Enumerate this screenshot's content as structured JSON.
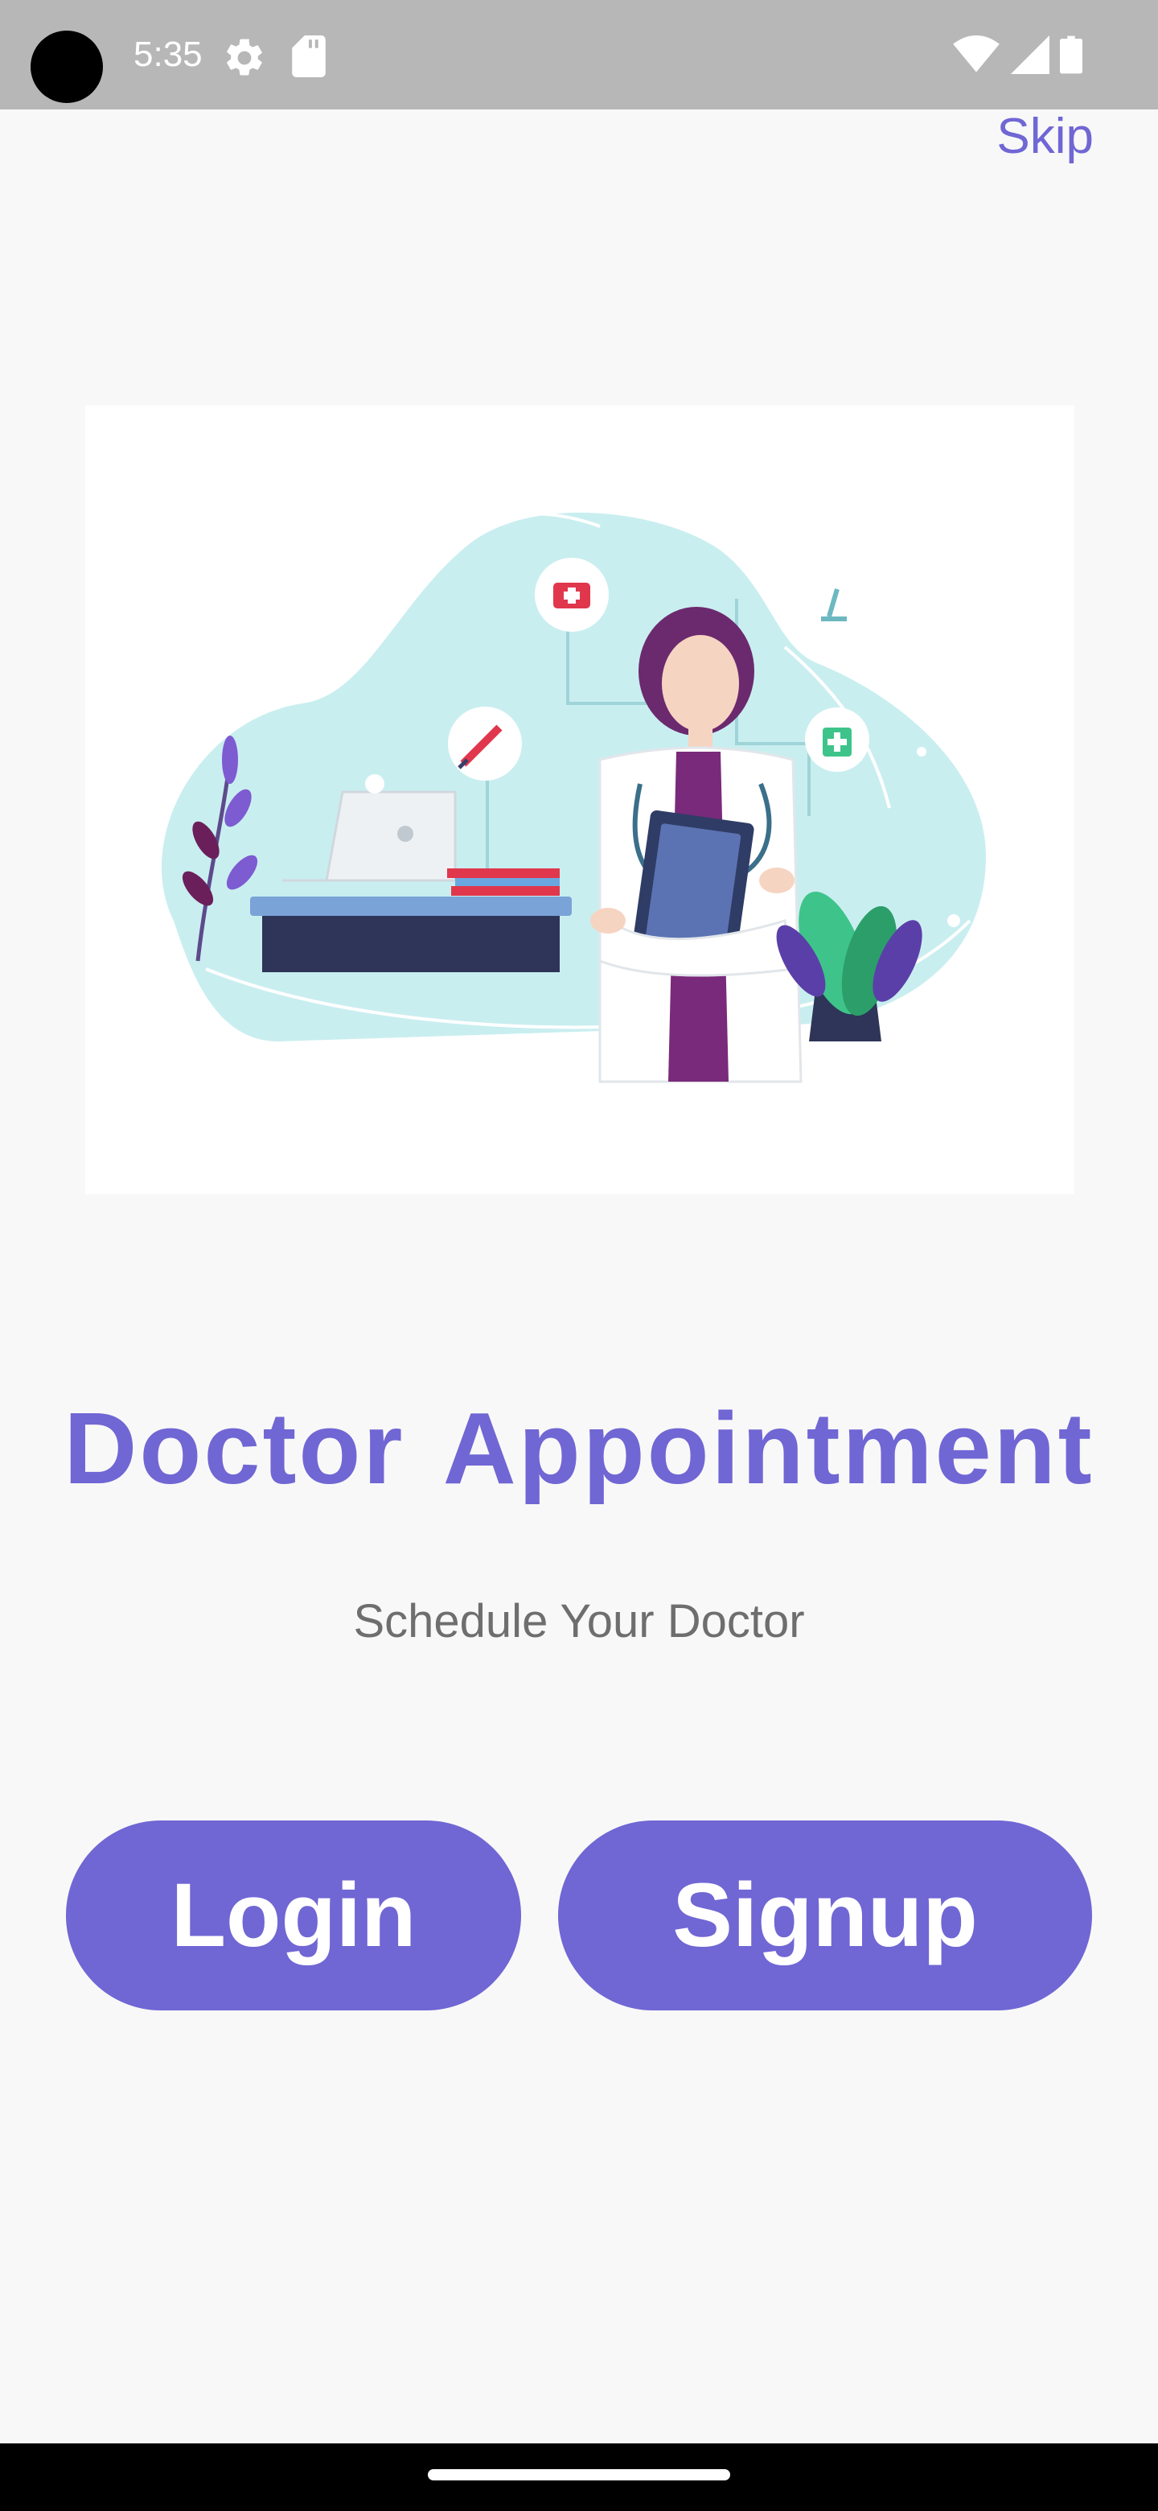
{
  "status_bar": {
    "time": "5:35",
    "icons": [
      "settings-gear-icon",
      "sd-card-icon",
      "wifi-icon",
      "cellular-signal-icon",
      "battery-icon"
    ]
  },
  "header": {
    "skip_label": "Skip"
  },
  "hero": {
    "illustration_icon": "doctor-illustration"
  },
  "main": {
    "title": "Doctor Appointment",
    "subtitle": "Schedule Your Doctor"
  },
  "actions": {
    "login_label": "Login",
    "signup_label": "Signup"
  },
  "colors": {
    "accent": "#7066d4",
    "background": "#f8f8f8",
    "status_bar": "#b7b7b7",
    "subtitle_text": "#6e6e6e"
  }
}
